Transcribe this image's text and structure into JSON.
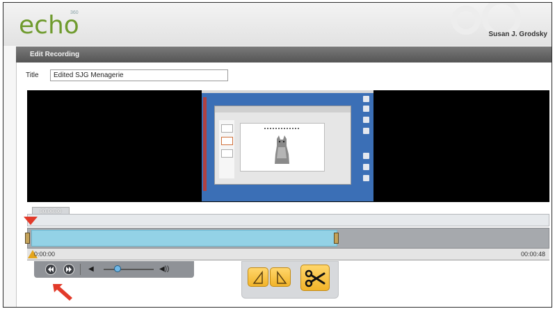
{
  "header": {
    "logo_text": "echo",
    "logo_superscript": "360",
    "user_name": "Susan J. Grodsky"
  },
  "panel": {
    "title": "Edit Recording"
  },
  "title_field": {
    "label": "Title",
    "value": "Edited SJG Menagerie"
  },
  "timeline": {
    "current_time_chip": "00:00:00",
    "start_time": "0:00:00",
    "end_time": "00:00:48"
  },
  "controls": {
    "rewind_icon": "rewind-icon",
    "forward_icon": "fast-forward-icon",
    "volume_mute_glyph": "◀",
    "volume_loud_glyph": "◀))",
    "volume_level": 0.25
  },
  "edit_tools": {
    "mark_in_icon": "mark-in-triangle-icon",
    "mark_out_icon": "mark-out-triangle-icon",
    "cut_icon": "scissors-icon"
  },
  "colors": {
    "accent_green": "#6f9b2e",
    "selection_blue": "#93d2e6",
    "playhead_red": "#e23a2a",
    "tool_orange": "#f2b429"
  }
}
